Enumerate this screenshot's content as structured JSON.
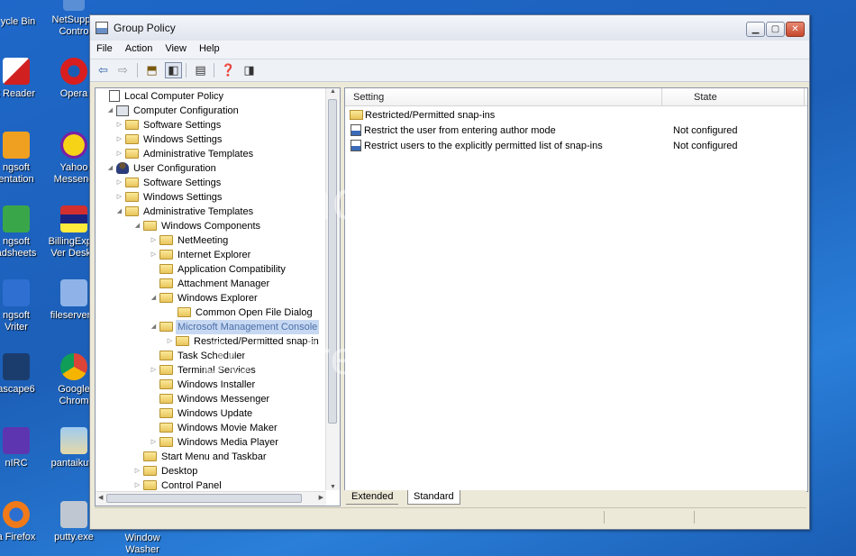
{
  "desktop": {
    "icons": [
      {
        "line1": "ycle Bin",
        "line2": ""
      },
      {
        "line1": "NetSuppo",
        "line2": "Contro"
      },
      {
        "line1": "t Reader",
        "line2": ""
      },
      {
        "line1": "Opera",
        "line2": ""
      },
      {
        "line1": "ngsoft",
        "line2": "entation"
      },
      {
        "line1": "Yahoo",
        "line2": "Messeng"
      },
      {
        "line1": "ngsoft",
        "line2": "adsheets"
      },
      {
        "line1": "BillingExple",
        "line2": "Ver DeskF"
      },
      {
        "line1": "ngsoft",
        "line2": "Vriter"
      },
      {
        "line1": "fileserverC",
        "line2": ""
      },
      {
        "line1": "ascape6",
        "line2": ""
      },
      {
        "line1": "Google",
        "line2": "Chrom"
      },
      {
        "line1": "nIRC",
        "line2": ""
      },
      {
        "line1": "pantaikuta",
        "line2": ""
      },
      {
        "line1": "a Firefox",
        "line2": ""
      },
      {
        "line1": "putty.exe",
        "line2": ""
      },
      {
        "line1": "Window",
        "line2": "Washer"
      }
    ]
  },
  "window": {
    "title": "Group Policy",
    "menu": [
      "File",
      "Action",
      "View",
      "Help"
    ]
  },
  "tree": {
    "nodes": [
      {
        "label": "Local Computer Policy",
        "icon": "doc",
        "expander": ""
      },
      {
        "label": "Computer Configuration",
        "icon": "pc",
        "expander": "◢"
      },
      {
        "label": "Software Settings",
        "icon": "folder",
        "expander": "▷"
      },
      {
        "label": "Windows Settings",
        "icon": "folder",
        "expander": "▷"
      },
      {
        "label": "Administrative Templates",
        "icon": "folder",
        "expander": "▷"
      },
      {
        "label": "User Configuration",
        "icon": "user",
        "expander": "◢"
      },
      {
        "label": "Software Settings",
        "icon": "folder",
        "expander": "▷"
      },
      {
        "label": "Windows Settings",
        "icon": "folder",
        "expander": "▷"
      },
      {
        "label": "Administrative Templates",
        "icon": "folder",
        "expander": "◢"
      },
      {
        "label": "Windows Components",
        "icon": "folder",
        "expander": "◢"
      },
      {
        "label": "NetMeeting",
        "icon": "folder",
        "expander": "▷"
      },
      {
        "label": "Internet Explorer",
        "icon": "folder",
        "expander": "▷"
      },
      {
        "label": "Application Compatibility",
        "icon": "folder",
        "expander": ""
      },
      {
        "label": "Attachment Manager",
        "icon": "folder",
        "expander": ""
      },
      {
        "label": "Windows Explorer",
        "icon": "folder",
        "expander": "◢"
      },
      {
        "label": "Common Open File Dialog",
        "icon": "folder",
        "expander": ""
      },
      {
        "label": "Microsoft Management Console",
        "icon": "folder",
        "expander": "◢"
      },
      {
        "label": "Restricted/Permitted snap-in",
        "icon": "folder",
        "expander": "▷"
      },
      {
        "label": "Task Scheduler",
        "icon": "folder",
        "expander": ""
      },
      {
        "label": "Terminal Services",
        "icon": "folder",
        "expander": "▷"
      },
      {
        "label": "Windows Installer",
        "icon": "folder",
        "expander": ""
      },
      {
        "label": "Windows Messenger",
        "icon": "folder",
        "expander": ""
      },
      {
        "label": "Windows Update",
        "icon": "folder",
        "expander": ""
      },
      {
        "label": "Windows Movie Maker",
        "icon": "folder",
        "expander": ""
      },
      {
        "label": "Windows Media Player",
        "icon": "folder",
        "expander": "▷"
      },
      {
        "label": "Start Menu and Taskbar",
        "icon": "folder",
        "expander": ""
      },
      {
        "label": "Desktop",
        "icon": "folder",
        "expander": "▷"
      },
      {
        "label": "Control Panel",
        "icon": "folder",
        "expander": "▷"
      }
    ],
    "selected_index": 16
  },
  "list": {
    "columns": [
      "Setting",
      "State"
    ],
    "rows": [
      {
        "setting": "Restricted/Permitted snap-ins",
        "state": "",
        "icon": "folder"
      },
      {
        "setting": "Restrict the user from entering author mode",
        "state": "Not configured",
        "icon": "policy"
      },
      {
        "setting": "Restrict users to the explicitly permitted list of snap-ins",
        "state": "Not configured",
        "icon": "policy"
      }
    ]
  },
  "tabs": [
    "Extended",
    "Standard"
  ],
  "watermark": {
    "line1": "photobucket",
    "line2": "Join free. Share privately."
  }
}
